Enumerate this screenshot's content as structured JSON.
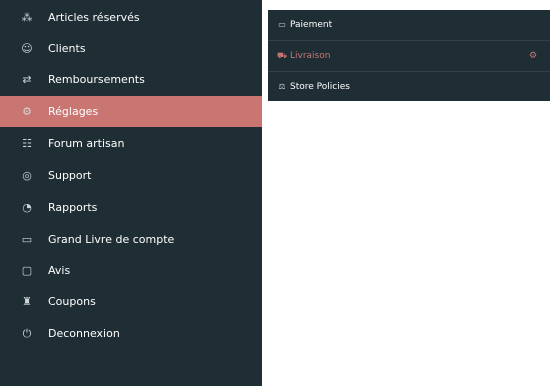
{
  "sidebar": {
    "items": [
      {
        "label": "Articles réservés",
        "icon": "reserved-icon"
      },
      {
        "label": "Clients",
        "icon": "clients-icon"
      },
      {
        "label": "Remboursements",
        "icon": "refund-icon"
      },
      {
        "label": "Réglages",
        "icon": "settings-icon"
      },
      {
        "label": "Forum artisan",
        "icon": "forum-icon"
      },
      {
        "label": "Support",
        "icon": "support-icon"
      },
      {
        "label": "Rapports",
        "icon": "reports-icon"
      },
      {
        "label": "Grand Livre de compte",
        "icon": "ledger-icon"
      },
      {
        "label": "Avis",
        "icon": "reviews-icon"
      },
      {
        "label": "Coupons",
        "icon": "coupons-icon"
      },
      {
        "label": "Deconnexion",
        "icon": "logout-icon"
      }
    ],
    "active_index": 3
  },
  "settings_submenu": {
    "items": [
      {
        "label": "Paiement",
        "icon": "payment-icon"
      },
      {
        "label": "Livraison",
        "icon": "shipping-icon"
      },
      {
        "label": "Store Policies",
        "icon": "policies-icon"
      }
    ],
    "active_index": 1
  },
  "colors": {
    "sidebar_bg": "#1f2d35",
    "active_bg": "#c97672",
    "text": "#ffffff"
  }
}
